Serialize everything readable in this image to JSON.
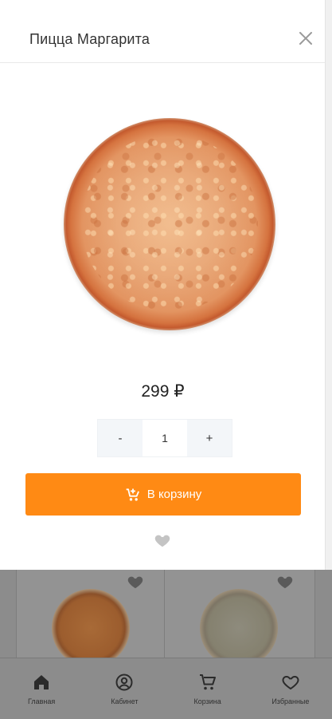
{
  "modal": {
    "title": "Пицца Маргарита",
    "price": "299 ₽",
    "quantity": {
      "minus": "-",
      "value": "1",
      "plus": "+"
    },
    "add_to_cart_label": "В корзину",
    "icons": {
      "close": "close-icon",
      "cart": "cart-plus-icon",
      "favorite": "heart-icon"
    }
  },
  "background_grid": {
    "cards": [
      {
        "name": "margherita-card",
        "favorite_icon": "heart-icon"
      },
      {
        "name": "cheese-card",
        "favorite_icon": "heart-icon"
      }
    ]
  },
  "bottom_nav": {
    "items": [
      {
        "label": "Главная",
        "icon": "home-icon"
      },
      {
        "label": "Кабинет",
        "icon": "account-icon"
      },
      {
        "label": "Корзина",
        "icon": "cart-icon"
      },
      {
        "label": "Избранные",
        "icon": "heart-outline-icon"
      }
    ]
  },
  "colors": {
    "accent": "#ff8a14",
    "overlay": "#8f8f8f"
  }
}
